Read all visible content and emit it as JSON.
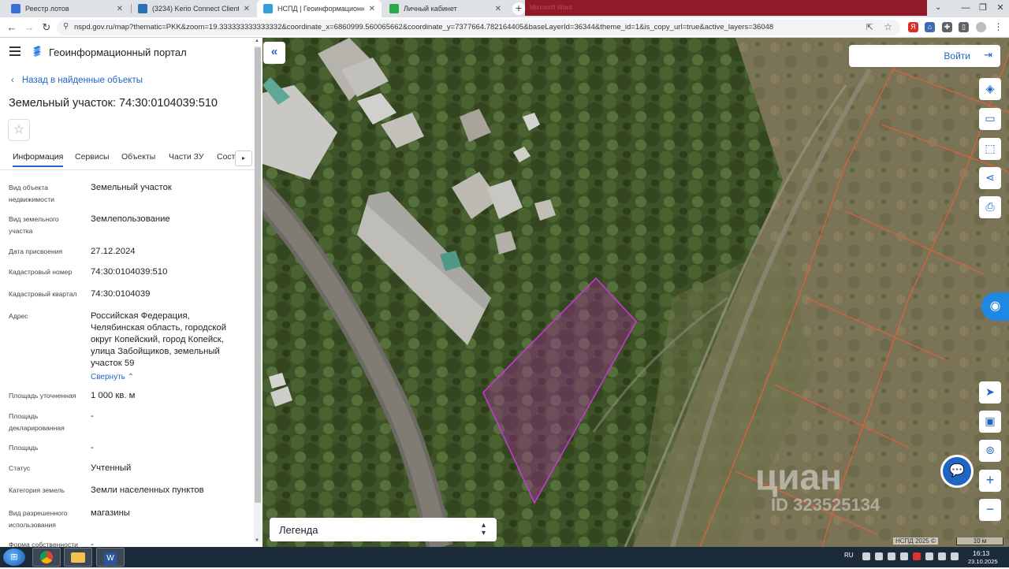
{
  "browser": {
    "tabs": [
      {
        "title": "Реестр лотов",
        "favicon_color": "#3b6fd8"
      },
      {
        "title": "(3234) Kerio Connect Client",
        "favicon_color": "#2f6fb8"
      },
      {
        "title": "НСПД | Геоинформационный п",
        "favicon_color": "#33a0dd"
      },
      {
        "title": "Личный кабинет",
        "favicon_color": "#2aa84a"
      }
    ],
    "new_tab": "+",
    "faded_tab": "Microsoft Word",
    "url": "nspd.gov.ru/map?thematic=PKK&zoom=19.333333333333332&coordinate_x=6860999.560065662&coordinate_y=7377664.782164405&baseLayerId=36344&theme_id=1&is_copy_url=true&active_layers=36048"
  },
  "header": {
    "portal_title": "Геоинформационный портал"
  },
  "panel": {
    "back_label": "Назад в найденные объекты",
    "title": "Земельный участок: 74:30:0104039:510",
    "tabs": [
      "Информация",
      "Сервисы",
      "Объекты",
      "Части ЗУ",
      "Соста"
    ],
    "fields": [
      {
        "label": "Вид объекта недвижимости",
        "value": "Земельный участок"
      },
      {
        "label": "Вид земельного участка",
        "value": "Землепользование"
      },
      {
        "label": "Дата присвоения",
        "value": "27.12.2024"
      },
      {
        "label": "Кадастровый номер",
        "value": "74:30:0104039:510"
      },
      {
        "label": "Кадастровый квартал",
        "value": "74:30:0104039"
      },
      {
        "label": "Адрес",
        "value": "Российская Федерация, Челябинская область, городской округ Копейский, город Копейск, улица Забойщиков, земельный участок 59"
      },
      {
        "label": "Площадь уточненная",
        "value": "1 000 кв. м"
      },
      {
        "label": "Площадь декларированная",
        "value": "-"
      },
      {
        "label": "Площадь",
        "value": "-"
      },
      {
        "label": "Статус",
        "value": "Учтенный"
      },
      {
        "label": "Категория земель",
        "value": "Земли населенных пунктов"
      },
      {
        "label": "Вид разрешенного использования",
        "value": "магазины"
      },
      {
        "label": "Форма собственности",
        "value": "-"
      }
    ],
    "collapse_label": "Свернуть"
  },
  "map": {
    "login_label": "Войти",
    "legend_label": "Легенда",
    "attribution": "НСПД 2025 ©",
    "scale_label": "10 м",
    "watermark": "циан",
    "watermark_id": "ID 323525134",
    "parcel_color": "#b02aa6",
    "quarter_border_color": "#e2603c",
    "tools": [
      "layers-icon",
      "ruler-icon",
      "select-area-icon",
      "share-icon",
      "print-icon"
    ],
    "tools_lower": [
      "geolocation-icon",
      "minimap-icon",
      "location-search-icon",
      "zoom-in-icon",
      "zoom-out-icon"
    ]
  },
  "taskbar": {
    "lang": "RU",
    "time": "16:13",
    "date": "23.10.2025"
  }
}
